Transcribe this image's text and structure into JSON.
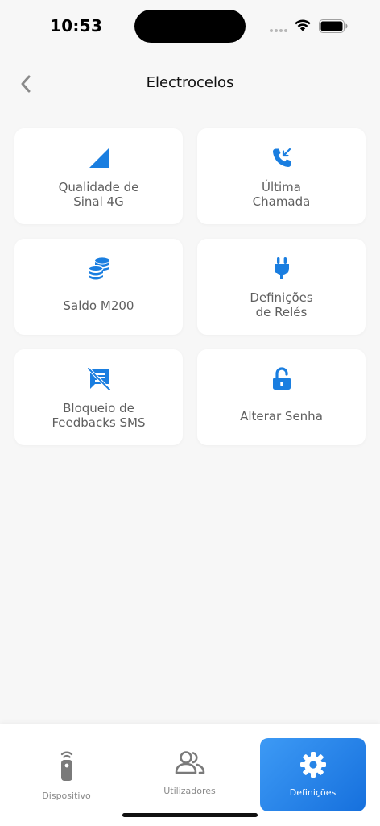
{
  "status_bar": {
    "time": "10:53"
  },
  "header": {
    "title": "Electrocelos"
  },
  "cards": [
    {
      "label": "Qualidade de\nSinal 4G",
      "icon": "signal-strength-icon"
    },
    {
      "label": "Última\nChamada",
      "icon": "phone-incoming-icon"
    },
    {
      "label": "Saldo M200",
      "icon": "coins-icon"
    },
    {
      "label": "Definições\nde Relés",
      "icon": "plug-icon"
    },
    {
      "label": "Bloqueio de\nFeedbacks SMS",
      "icon": "sms-off-icon"
    },
    {
      "label": "Alterar Senha",
      "icon": "unlock-icon"
    }
  ],
  "tabbar": {
    "tabs": [
      {
        "label": "Dispositivo",
        "icon": "remote-icon",
        "active": false
      },
      {
        "label": "Utilizadores",
        "icon": "users-icon",
        "active": false
      },
      {
        "label": "Definições",
        "icon": "gear-icon",
        "active": true
      }
    ]
  },
  "colors": {
    "accent": "#1a7ee0",
    "background": "#f7f7f7",
    "icon_gray": "#7a7a7a"
  }
}
